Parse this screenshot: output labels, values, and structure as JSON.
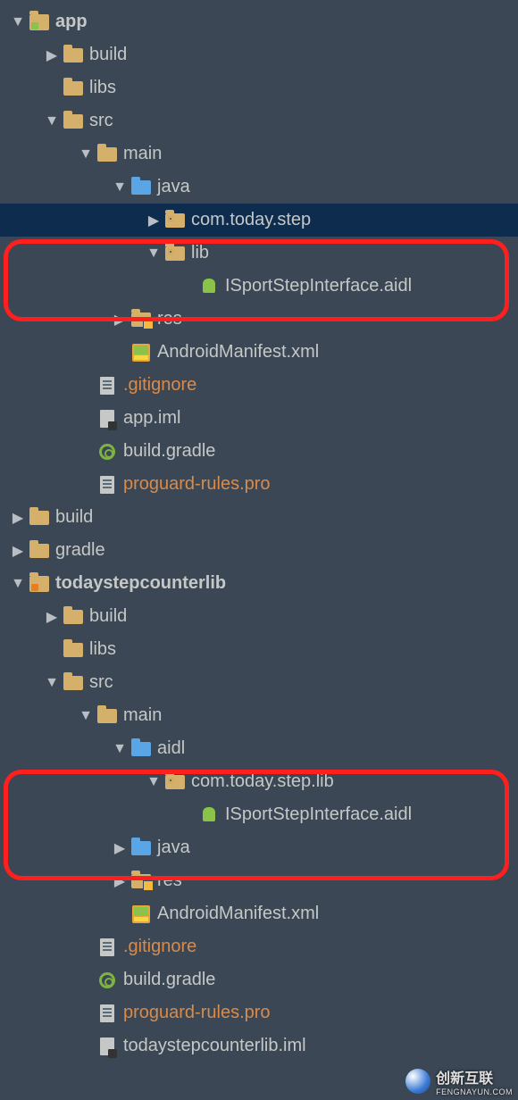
{
  "tree": {
    "app": "app",
    "build": "build",
    "libs": "libs",
    "src": "src",
    "main": "main",
    "java": "java",
    "com_today_step": "com.today.step",
    "lib": "lib",
    "isport_aidl": "ISportStepInterface.aidl",
    "res": "res",
    "manifest": "AndroidManifest.xml",
    "gitignore": ".gitignore",
    "app_iml": "app.iml",
    "build_gradle": "build.gradle",
    "proguard": "proguard-rules.pro",
    "gradle": "gradle",
    "todaystepcounterlib": "todaystepcounterlib",
    "aidl": "aidl",
    "com_today_step_lib": "com.today.step.lib",
    "todaystepcounterlib_iml": "todaystepcounterlib.iml"
  },
  "watermark": {
    "title": "创新互联",
    "sub": "FENGNAYUN.COM"
  }
}
